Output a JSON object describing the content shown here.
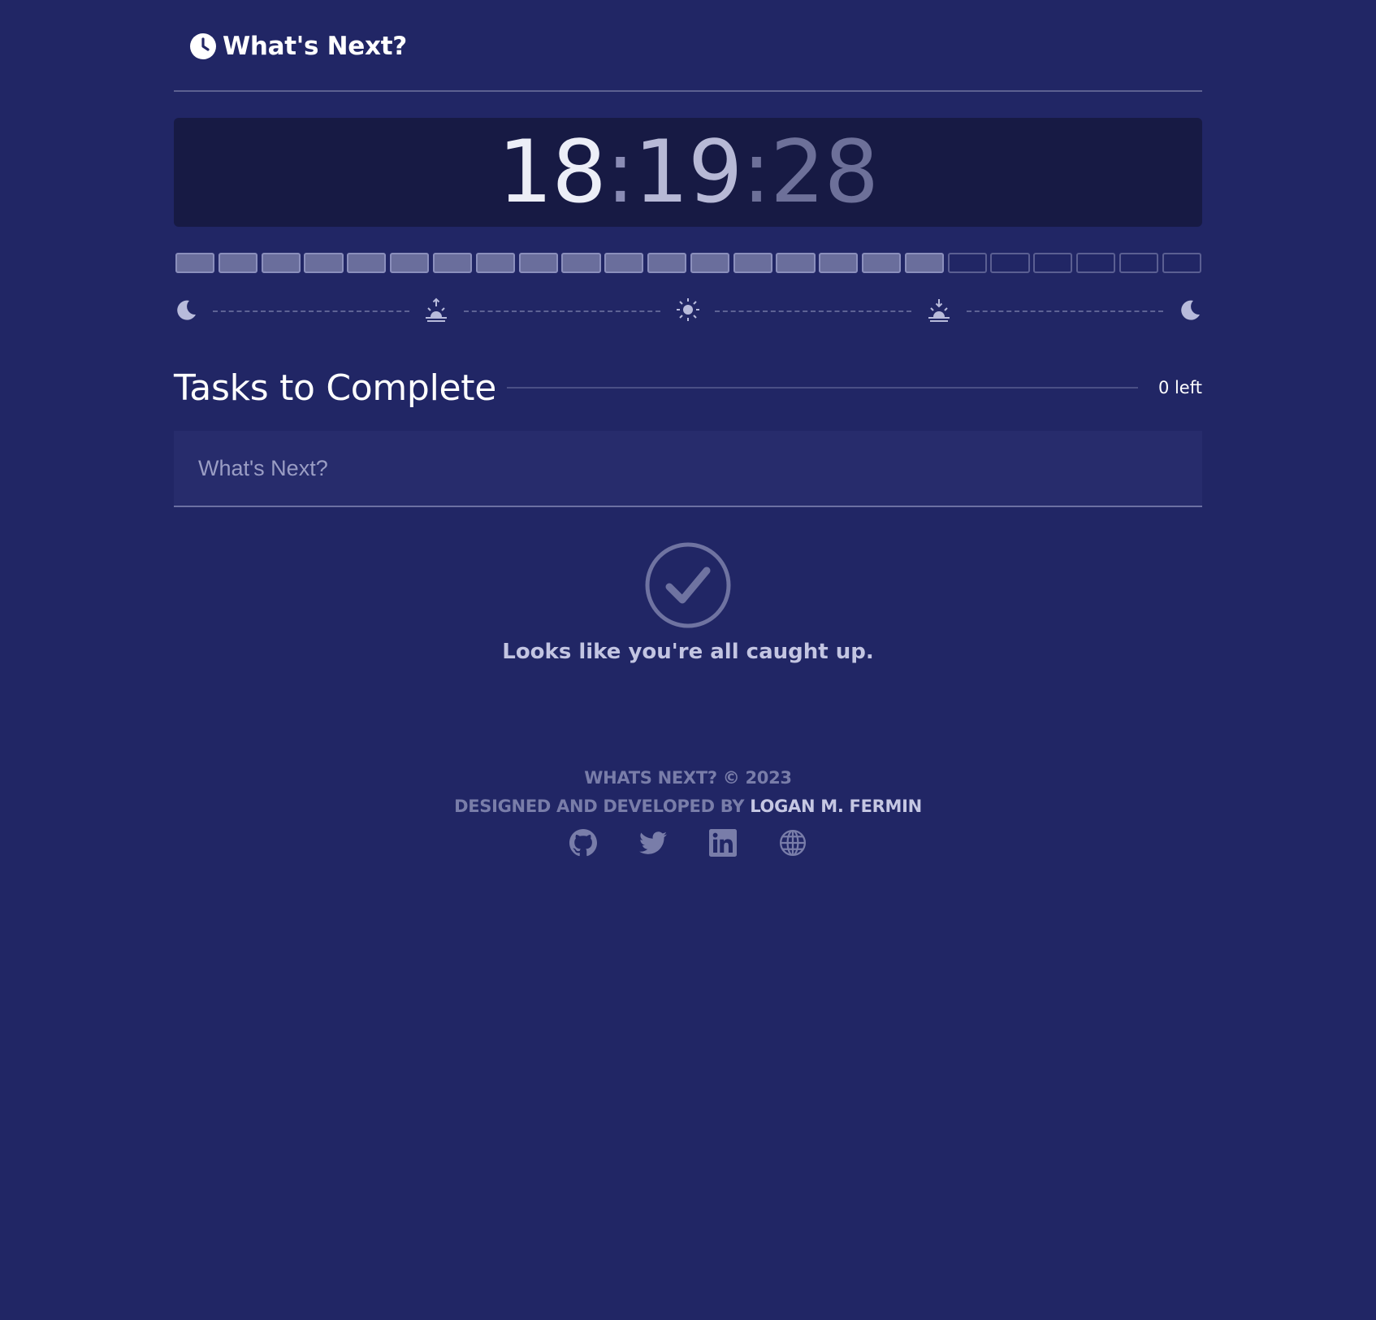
{
  "header": {
    "title": "What's Next?",
    "icon": "clock-icon"
  },
  "clock": {
    "hours": "18",
    "minutes": "19",
    "seconds": "28",
    "separator": ":"
  },
  "day_progress": {
    "total_hours": 24,
    "elapsed_hours": 18
  },
  "timeline": {
    "icons": [
      "moon-icon",
      "sunrise-icon",
      "sun-icon",
      "sunset-icon",
      "moon-icon"
    ]
  },
  "tasks": {
    "title": "Tasks to Complete",
    "count_label": "0 left",
    "input_placeholder": "What's Next?",
    "input_value": ""
  },
  "empty_state": {
    "icon": "check-circle-icon",
    "message": "Looks like you're all caught up."
  },
  "footer": {
    "copyright": "WHATS NEXT? © 2023",
    "credit_prefix": "DESIGNED AND DEVELOPED BY ",
    "author": "LOGAN M. FERMIN",
    "social_icons": [
      "github-icon",
      "twitter-icon",
      "linkedin-icon",
      "globe-icon"
    ]
  },
  "colors": {
    "background": "#212665",
    "clock_panel": "#171a44",
    "block_done": "#6a6e9c",
    "block_todo_border": "#5b5f92",
    "muted_text": "#797da9"
  }
}
